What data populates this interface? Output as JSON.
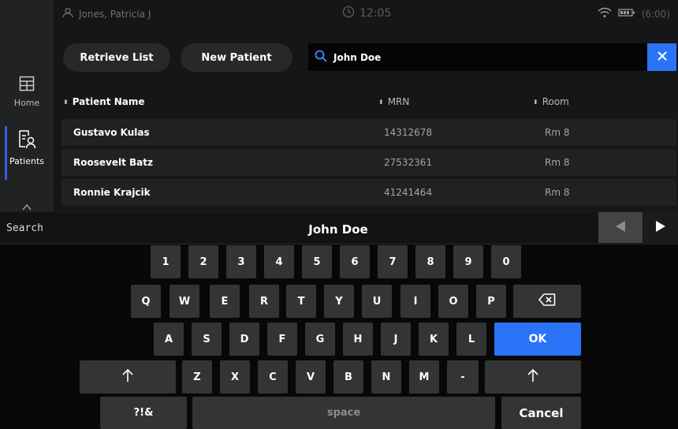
{
  "sidebar": {
    "home_label": "Home",
    "patients_label": "Patients",
    "active": "Patients"
  },
  "status": {
    "user": "Jones, Patricia J",
    "time": "12:05",
    "battery": "(6:00)"
  },
  "actions": {
    "retrieve_label": "Retrieve List",
    "new_patient_label": "New Patient"
  },
  "search": {
    "value": "John Doe"
  },
  "table": {
    "headers": {
      "name": "Patient Name",
      "mrn": "MRN",
      "room": "Room"
    },
    "rows": [
      {
        "name": "Gustavo Kulas",
        "mrn": "14312678",
        "room": "Rm 8"
      },
      {
        "name": "Roosevelt Batz",
        "mrn": "27532361",
        "room": "Rm 8"
      },
      {
        "name": "Ronnie Krajcik",
        "mrn": "41241464",
        "room": "Rm 8"
      }
    ]
  },
  "keyboard": {
    "search_label": "Search",
    "input_value": "John Doe",
    "row1": [
      "1",
      "2",
      "3",
      "4",
      "5",
      "6",
      "7",
      "8",
      "9",
      "0"
    ],
    "row2": [
      "Q",
      "W",
      "E",
      "R",
      "T",
      "Y",
      "U",
      "I",
      "O",
      "P"
    ],
    "row3": [
      "A",
      "S",
      "D",
      "F",
      "G",
      "H",
      "J",
      "K",
      "L"
    ],
    "row4": [
      "Z",
      "X",
      "C",
      "V",
      "B",
      "N",
      "M",
      "-"
    ],
    "ok_label": "OK",
    "symbols_label": "?!&",
    "space_label": "space",
    "cancel_label": "Cancel",
    "accent_color": "#2b74f7"
  }
}
